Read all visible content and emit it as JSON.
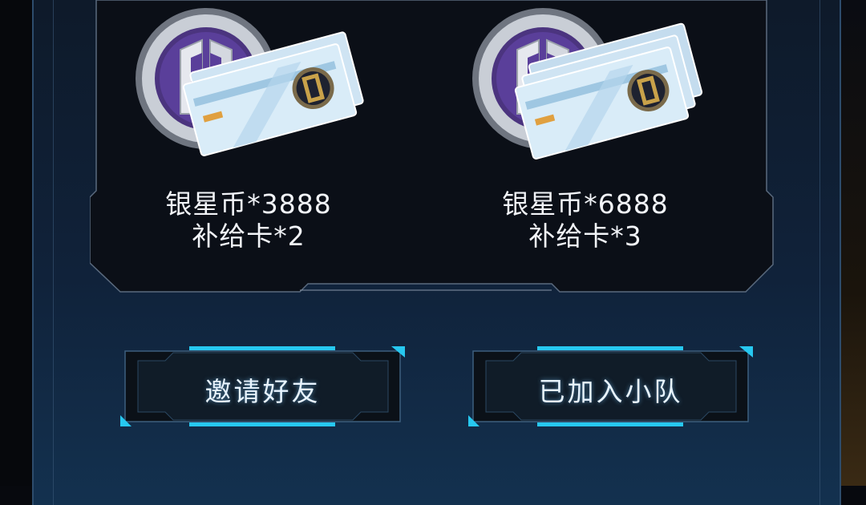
{
  "rewards": [
    {
      "coin_label": "银星币*3888",
      "card_label": "补给卡*2",
      "card_count": 2
    },
    {
      "coin_label": "银星币*6888",
      "card_label": "补给卡*3",
      "card_count": 3
    }
  ],
  "buttons": {
    "invite_label": "邀请好友",
    "joined_label": "已加入小队"
  },
  "colors": {
    "accent_cyan": "#27c8f0",
    "panel_dark": "#0b0f17",
    "coin_purple": "#5a3f9a",
    "gold": "#c9a24a"
  },
  "icons": [
    "silver-star-coin-icon",
    "supply-card-icon"
  ]
}
